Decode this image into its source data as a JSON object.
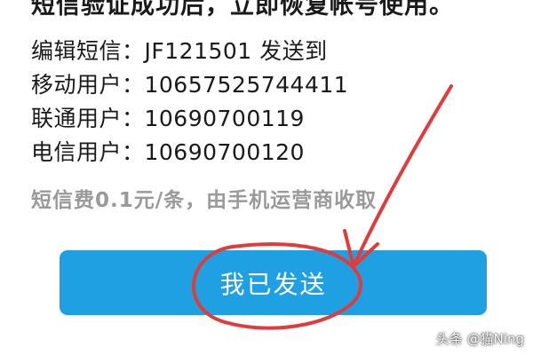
{
  "header": {
    "title_clipped": "短信验证成功后，立即恢复帐号使用。"
  },
  "instructions": {
    "edit_sms": "编辑短信：JF121501 发送到",
    "mobile": "移动用户：10657525744411",
    "unicom": "联通用户：10690700119",
    "telecom": "电信用户：10690700120"
  },
  "fee_note": "短信费0.1元/条，由手机运营商收取",
  "send_button": {
    "label": "我已发送"
  },
  "watermark": "头条 @猫Ning",
  "colors": {
    "button": "#1fa0e3",
    "annotation": "#e03c3c",
    "fee_text": "#9a9a9a"
  }
}
